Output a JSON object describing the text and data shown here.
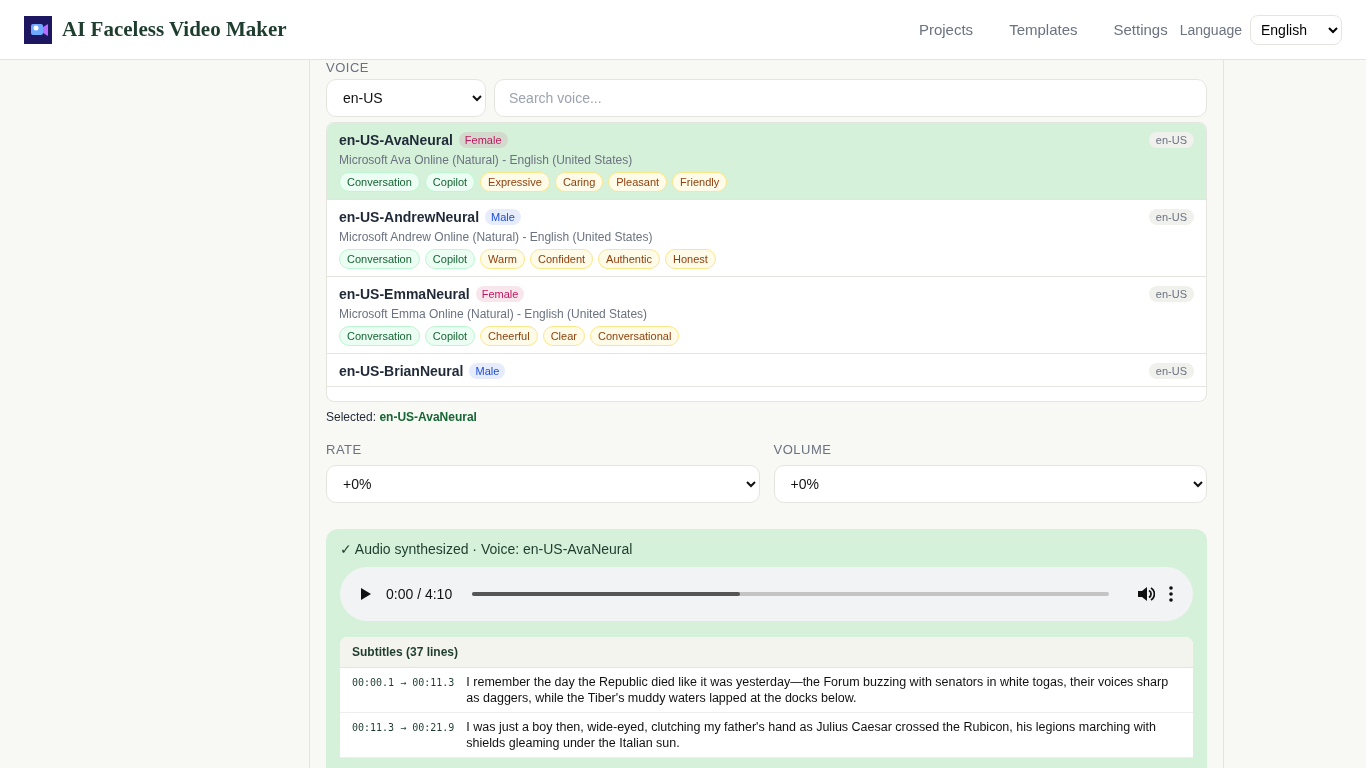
{
  "header": {
    "title": "AI Faceless Video Maker",
    "nav": [
      {
        "label": "Projects"
      },
      {
        "label": "Templates"
      },
      {
        "label": "Settings"
      }
    ],
    "language_label": "Language",
    "language_value": "English"
  },
  "voice": {
    "label": "VOICE",
    "locale_value": "en-US",
    "search_placeholder": "Search voice...",
    "items": [
      {
        "name": "en-US-AvaNeural",
        "gender": {
          "label": "Female",
          "color": "#be185d"
        },
        "description": "Microsoft Ava Online (Natural) - English (United States)",
        "locale": "en-US",
        "selected": true,
        "tags": [
          {
            "label": "Conversation",
            "kind": "category"
          },
          {
            "label": "Copilot",
            "kind": "category"
          },
          {
            "label": "Expressive",
            "kind": "style"
          },
          {
            "label": "Caring",
            "kind": "style"
          },
          {
            "label": "Pleasant",
            "kind": "style"
          },
          {
            "label": "Friendly",
            "kind": "style"
          }
        ]
      },
      {
        "name": "en-US-AndrewNeural",
        "gender": {
          "label": "Male",
          "color": "#1d4ed8"
        },
        "description": "Microsoft Andrew Online (Natural) - English (United States)",
        "locale": "en-US",
        "selected": false,
        "tags": [
          {
            "label": "Conversation",
            "kind": "category"
          },
          {
            "label": "Copilot",
            "kind": "category"
          },
          {
            "label": "Warm",
            "kind": "style"
          },
          {
            "label": "Confident",
            "kind": "style"
          },
          {
            "label": "Authentic",
            "kind": "style"
          },
          {
            "label": "Honest",
            "kind": "style"
          }
        ]
      },
      {
        "name": "en-US-EmmaNeural",
        "gender": {
          "label": "Female",
          "color": "#be185d"
        },
        "description": "Microsoft Emma Online (Natural) - English (United States)",
        "locale": "en-US",
        "selected": false,
        "tags": [
          {
            "label": "Conversation",
            "kind": "category"
          },
          {
            "label": "Copilot",
            "kind": "category"
          },
          {
            "label": "Cheerful",
            "kind": "style"
          },
          {
            "label": "Clear",
            "kind": "style"
          },
          {
            "label": "Conversational",
            "kind": "style"
          }
        ]
      },
      {
        "name": "en-US-BrianNeural",
        "gender": {
          "label": "Male",
          "color": "#1d4ed8"
        },
        "locale": "en-US",
        "selected": false
      }
    ],
    "selected_label": "Selected:",
    "selected_value": "en-US-AvaNeural"
  },
  "rate": {
    "label": "RATE",
    "value": "+0%"
  },
  "volume": {
    "label": "VOLUME",
    "value": "+0%"
  },
  "result": {
    "status": "✓ Audio synthesized · Voice: en-US-AvaNeural",
    "player": {
      "time": "0:00 / 4:10",
      "level": 0.42
    },
    "subtitles": {
      "title": "Subtitles (37 lines)",
      "rows": [
        {
          "time": "00:00.1 → 00:11.3",
          "text": "I remember the day the Republic died like it was yesterday—the Forum buzzing with senators in white togas, their voices sharp as daggers, while the Tiber's muddy waters lapped at the docks below."
        },
        {
          "time": "00:11.3 → 00:21.9",
          "text": "I was just a boy then, wide-eyed, clutching my father's hand as Julius Caesar crossed the Rubicon, his legions marching with shields gleaming under the Italian sun."
        }
      ]
    }
  }
}
